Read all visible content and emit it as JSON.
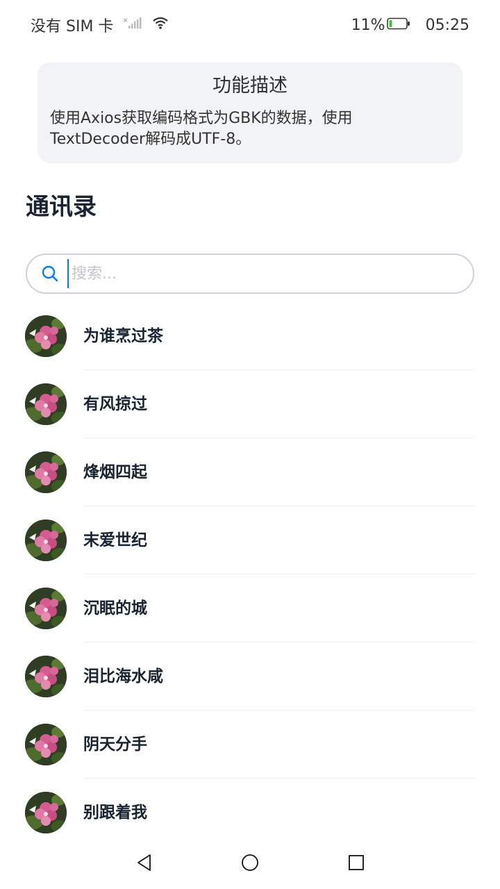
{
  "status_bar": {
    "carrier": "没有 SIM 卡",
    "battery": "11%",
    "time": "05:25"
  },
  "description": {
    "title": "功能描述",
    "text": "使用Axios获取编码格式为GBK的数据，使用TextDecoder解码成UTF-8。"
  },
  "page_title": "通讯录",
  "search": {
    "value": "",
    "placeholder": "搜索..."
  },
  "contacts": [
    {
      "name": "为谁烹过茶"
    },
    {
      "name": "有风掠过"
    },
    {
      "name": "烽烟四起"
    },
    {
      "name": "末爱世纪"
    },
    {
      "name": "沉眠的城"
    },
    {
      "name": "泪比海水咸"
    },
    {
      "name": "阴天分手"
    },
    {
      "name": "别跟着我"
    }
  ],
  "icons": {
    "search": "search-icon",
    "signal": "signal-icon",
    "wifi": "wifi-icon",
    "battery": "battery-icon",
    "back": "back-icon",
    "home": "home-icon",
    "recents": "recents-icon"
  },
  "colors": {
    "accent": "#007dff",
    "battery_fill": "#3cc13b",
    "card_bg": "#f1f3f5",
    "text_primary": "#182431"
  }
}
